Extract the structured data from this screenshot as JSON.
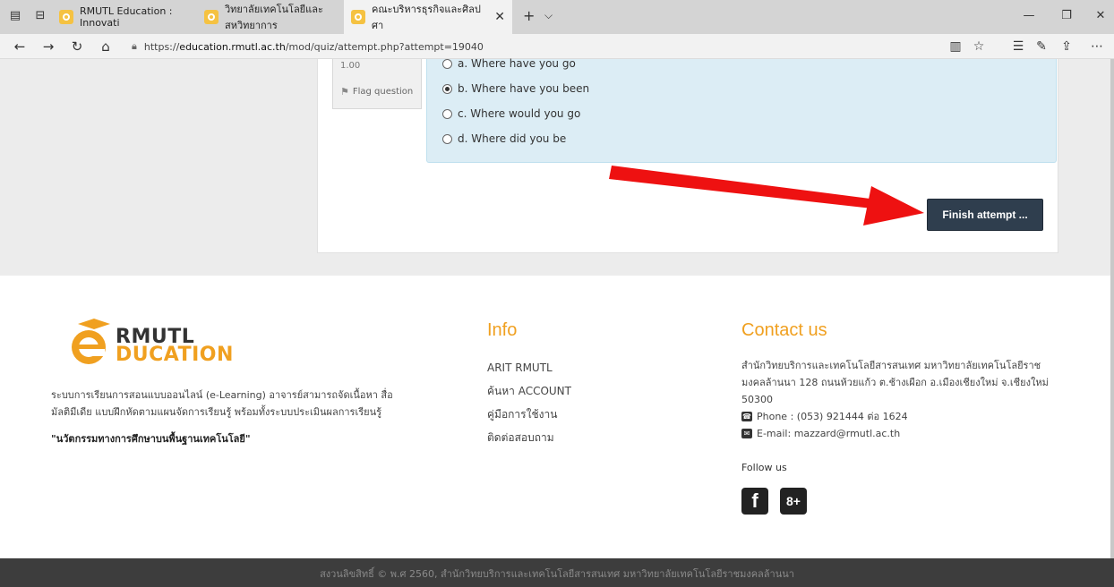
{
  "browser": {
    "tabs": [
      {
        "title": "RMUTL Education : Innovati"
      },
      {
        "title": "วิทยาลัยเทคโนโลยีและสหวิทยาการ"
      },
      {
        "title": "คณะบริหารธุรกิจและศิลปศา"
      }
    ],
    "close_glyph": "✕",
    "newtab_glyph": "+",
    "dropdown_glyph": "⌵",
    "url_prefix": "https://",
    "url_host": "education.rmutl.ac.th",
    "url_path": "/mod/quiz/attempt.php?attempt=19040"
  },
  "quiz": {
    "mark": "1.00",
    "flag_label": "Flag question",
    "options": [
      {
        "label": "a. Where have you go",
        "checked": false
      },
      {
        "label": "b. Where have you been",
        "checked": true
      },
      {
        "label": "c. Where would you go",
        "checked": false
      },
      {
        "label": "d. Where did you be",
        "checked": false
      }
    ],
    "finish_button": "Finish attempt ..."
  },
  "annotation": {
    "arrow_color": "#ee1111"
  },
  "footer": {
    "logo_line1": "RMUTL",
    "logo_line2": "DUCATION",
    "about": "ระบบการเรียนการสอนแบบออนไลน์ (e-Learning) อาจารย์สามารถจัดเนื้อหา สื่อมัลติมีเดีย แบบฝึกหัดตามแผนจัดการเรียนรู้ พร้อมทั้งระบบประเมินผลการเรียนรู้",
    "slogan": "\"นวัตกรรมทางการศึกษาบนพื้นฐานเทคโนโลยี\"",
    "info_title": "Info",
    "info_links": [
      "ARIT RMUTL",
      "ค้นหา ACCOUNT",
      "คู่มือการใช้งาน",
      "ติดต่อสอบถาม"
    ],
    "contact_title": "Contact us",
    "address": "สำนักวิทยบริการและเทคโนโลยีสารสนเทศ มหาวิทยาลัยเทคโนโลยีราชมงคลล้านนา 128 ถนนห้วยแก้ว ต.ช้างเผือก อ.เมืองเชียงใหม่ จ.เชียงใหม่ 50300",
    "phone": "Phone : (053) 921444 ต่อ 1624",
    "email": "E-mail: mazzard@rmutl.ac.th",
    "follow_label": "Follow us",
    "social": [
      "f",
      "8+"
    ],
    "copyright": "สงวนลิขสิทธิ์ © พ.ศ 2560, สำนักวิทยบริการและเทคโนโลยีสารสนเทศ มหาวิทยาลัยเทคโนโลยีราชมงคลล้านนา"
  },
  "colors": {
    "accent": "#f0a020",
    "button": "#2f3e4e",
    "answer_bg": "#dcedf5"
  }
}
